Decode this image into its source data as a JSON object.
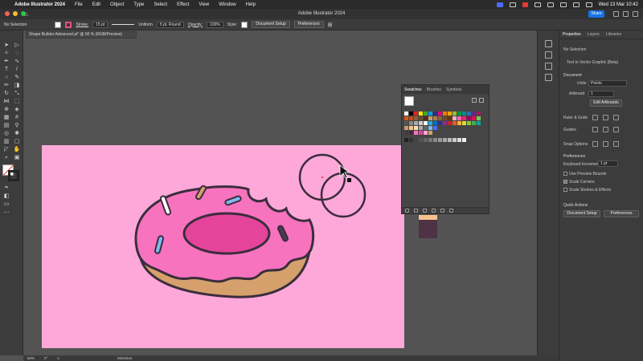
{
  "menubar": {
    "app_name": "Adobe Illustrator 2024",
    "items": [
      "File",
      "Edit",
      "Object",
      "Type",
      "Select",
      "Effect",
      "View",
      "Window",
      "Help"
    ],
    "clock": "Wed 13 Mar  10:42"
  },
  "titlebar": {
    "title": "Adobe Illustrator 2024",
    "share_label": "Share"
  },
  "controlbar": {
    "selection_label": "No Selection",
    "stroke_label": "Stroke:",
    "stroke_value": "15 pt",
    "profile_value": "Uniform",
    "brush_value": "5 pt. Round",
    "opacity_label": "Opacity:",
    "opacity_value": "100%",
    "style_label": "Style:",
    "doc_setup_label": "Document Setup",
    "preferences_label": "Preferences"
  },
  "document_tab": {
    "label": "Shape Builder Advanced.ai* @ 50 % (RGB/Preview)"
  },
  "statusbar": {
    "zoom": "50%",
    "rotation": "0°",
    "artboard_nav": "1",
    "tool_name": "Selection"
  },
  "swatches_panel": {
    "tabs": [
      "Swatches",
      "Brushes",
      "Symbols"
    ]
  },
  "properties_panel": {
    "tabs": [
      "Properties",
      "Layers",
      "Libraries"
    ],
    "selection": "No Selection",
    "text_to_vector": "Text to Vector Graphic (Beta)",
    "document_heading": "Document",
    "units_label": "Units",
    "units_value": "Points",
    "artboard_label": "Artboard",
    "artboard_value": "1",
    "edit_artboards_label": "Edit Artboards",
    "ruler_grids_label": "Ruler & Grids",
    "guides_label": "Guides",
    "snap_options_label": "Snap Options",
    "preferences_heading": "Preferences",
    "keyboard_increment_label": "Keyboard Increment",
    "keyboard_increment_value": "1 pt",
    "use_preview_bounds_label": "Use Preview Bounds",
    "scale_corners_label": "Scale Corners",
    "scale_strokes_label": "Scale Strokes & Effects",
    "quick_actions_heading": "Quick Actions",
    "doc_setup_button": "Document Setup",
    "preferences_button": "Preferences"
  },
  "colors": {
    "artboard": "#fea8d9",
    "icing": "#f773be",
    "icing_center": "#e4449a",
    "dough": "#d5a06c",
    "outline": "#3b2d3c",
    "accent_blue": "#1473e6"
  }
}
